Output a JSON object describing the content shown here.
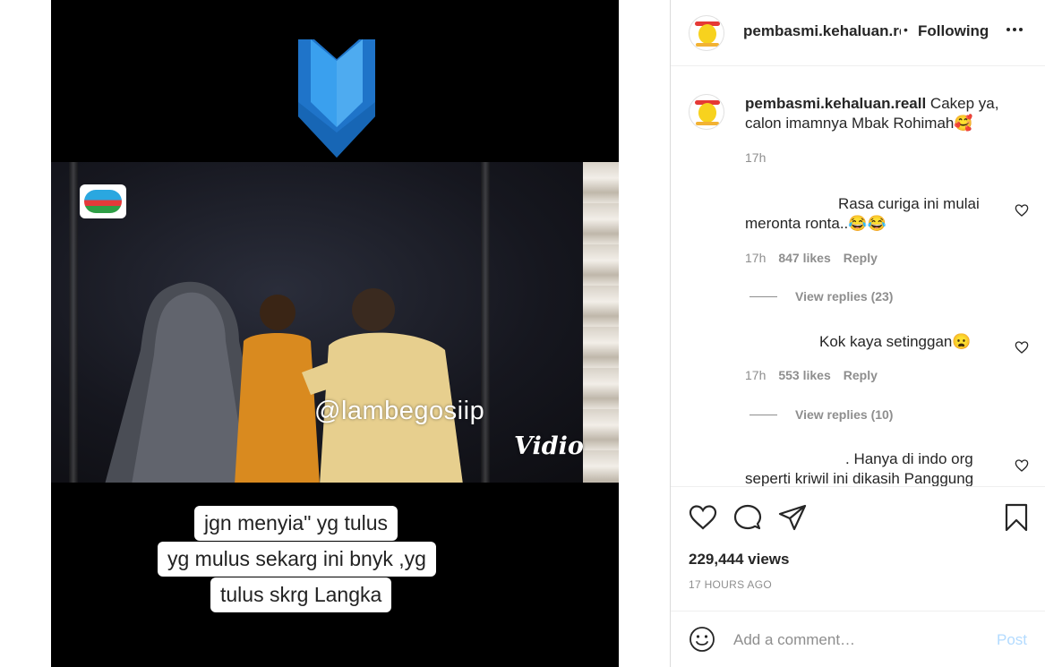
{
  "media": {
    "watermark": "@lambegosiip",
    "brand": "Vidio",
    "caption_lines": [
      "jgn menyia\" yg tulus",
      "yg mulus sekarg ini bnyk ,yg",
      "tulus skrg Langka"
    ]
  },
  "header": {
    "username": "pembasmi.kehaluan.reall",
    "separator": "•",
    "follow_label": "Following"
  },
  "caption": {
    "username": "pembasmi.kehaluan.reall",
    "text": " Cakep ya, calon imamnya Mbak Rohimah🥰",
    "time": "17h"
  },
  "comments": [
    {
      "text": "Rasa curiga ini mulai meronta ronta..😂😂",
      "time": "17h",
      "likes": "847 likes",
      "reply": "Reply",
      "view_replies": "View replies (23)"
    },
    {
      "text": "Kok kaya setinggan😦",
      "time": "17h",
      "likes": "553 likes",
      "reply": "Reply",
      "view_replies": "View replies (10)"
    },
    {
      "text": ". Hanya di indo org seperti kriwil ini dikasih Panggung"
    }
  ],
  "stats": {
    "views": "229,444 views",
    "posted": "17 HOURS AGO"
  },
  "add_comment": {
    "placeholder": "Add a comment…",
    "post_label": "Post"
  },
  "colors": {
    "accent_post_disabled": "#b3dbff",
    "muted_text": "#8e8e8e",
    "arrow_blue": "#2f8fe0"
  },
  "icons": [
    "more-icon",
    "heart-icon",
    "comment-icon",
    "share-icon",
    "bookmark-icon",
    "emoji-icon"
  ]
}
